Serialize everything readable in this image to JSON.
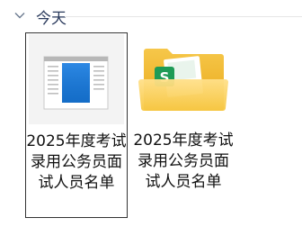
{
  "group": {
    "title": "今天",
    "chevron_icon": "chevron-down-icon"
  },
  "items": [
    {
      "name": "2025年度考试录用公务员面试人员名单",
      "icon": "document-thumbnail-icon",
      "selected": true
    },
    {
      "name": "2025年度考试录用公务员面试人员名单",
      "icon": "spreadsheet-folder-icon",
      "selected": false
    }
  ]
}
